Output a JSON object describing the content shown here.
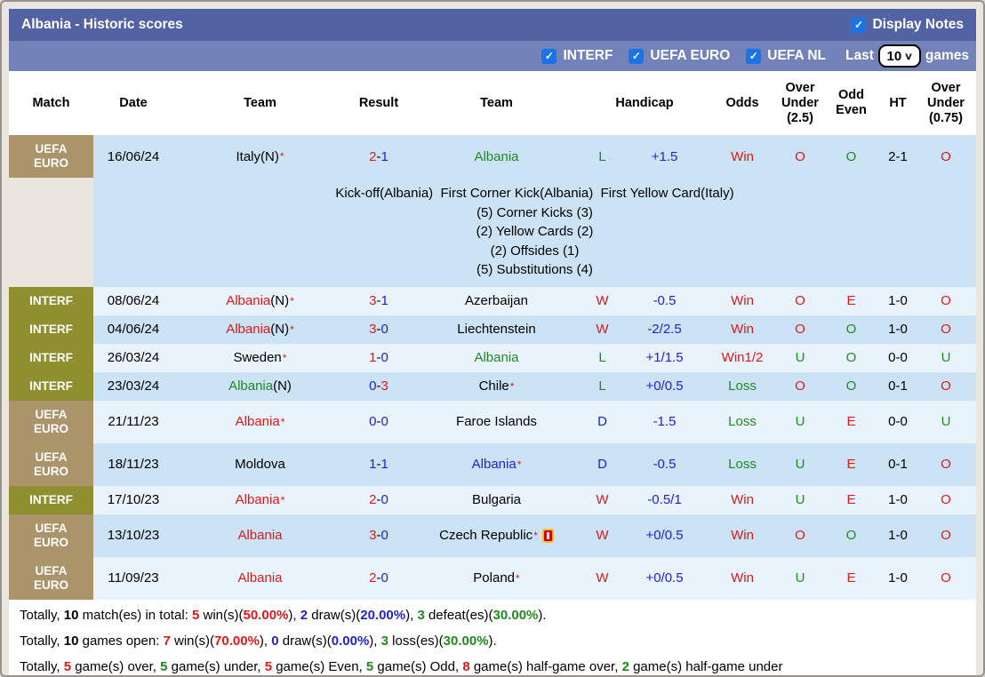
{
  "header": {
    "title": "Albania - Historic scores",
    "display_notes_label": "Display Notes",
    "filters": [
      {
        "label": "INTERF",
        "checked": true
      },
      {
        "label": "UEFA EURO",
        "checked": true
      },
      {
        "label": "UEFA NL",
        "checked": true
      }
    ],
    "last_label": "Last",
    "last_games_value": "10",
    "games_label": "games"
  },
  "table": {
    "columns": [
      "Match",
      "Date",
      "Team",
      "Result",
      "Team",
      "Handicap",
      "Odds",
      "Over Under (2.5)",
      "Odd Even",
      "HT",
      "Over Under (0.75)"
    ],
    "rows": [
      {
        "competition": "UEFA EURO",
        "date": "16/06/24",
        "home": {
          "name": "Italy",
          "suffix": "(N)",
          "star": true,
          "color": "black"
        },
        "score": {
          "home": "2",
          "away": "1",
          "home_color": "red",
          "away_color": "blue"
        },
        "away": {
          "name": "Albania",
          "suffix": "",
          "star": false,
          "color": "green"
        },
        "wdl": {
          "text": "L",
          "color": "green"
        },
        "handicap": "+1.5",
        "odds": {
          "text": "Win",
          "color": "red"
        },
        "over_under_25": {
          "text": "O",
          "color": "red"
        },
        "odd_even": {
          "text": "O",
          "color": "green"
        },
        "ht": "2-1",
        "over_under_075": {
          "text": "O",
          "color": "red"
        },
        "notes": [
          "Kick-off(Albania)  First Corner Kick(Albania)  First Yellow Card(Italy)",
          "(5) Corner Kicks (3)",
          "(2) Yellow Cards (2)",
          "(2) Offsides (1)",
          "(5) Substitutions (4)"
        ]
      },
      {
        "competition": "INTERF",
        "date": "08/06/24",
        "home": {
          "name": "Albania",
          "suffix": "(N)",
          "star": true,
          "color": "red"
        },
        "score": {
          "home": "3",
          "away": "1",
          "home_color": "red",
          "away_color": "blue"
        },
        "away": {
          "name": "Azerbaijan",
          "suffix": "",
          "star": false,
          "color": "black"
        },
        "wdl": {
          "text": "W",
          "color": "red"
        },
        "handicap": "-0.5",
        "odds": {
          "text": "Win",
          "color": "red"
        },
        "over_under_25": {
          "text": "O",
          "color": "red"
        },
        "odd_even": {
          "text": "E",
          "color": "red"
        },
        "ht": "1-0",
        "over_under_075": {
          "text": "O",
          "color": "red"
        }
      },
      {
        "competition": "INTERF",
        "date": "04/06/24",
        "home": {
          "name": "Albania",
          "suffix": "(N)",
          "star": true,
          "color": "red"
        },
        "score": {
          "home": "3",
          "away": "0",
          "home_color": "red",
          "away_color": "blue"
        },
        "away": {
          "name": "Liechtenstein",
          "suffix": "",
          "star": false,
          "color": "black"
        },
        "wdl": {
          "text": "W",
          "color": "red"
        },
        "handicap": "-2/2.5",
        "odds": {
          "text": "Win",
          "color": "red"
        },
        "over_under_25": {
          "text": "O",
          "color": "red"
        },
        "odd_even": {
          "text": "O",
          "color": "green"
        },
        "ht": "1-0",
        "over_under_075": {
          "text": "O",
          "color": "red"
        }
      },
      {
        "competition": "INTERF",
        "date": "26/03/24",
        "home": {
          "name": "Sweden",
          "suffix": "",
          "star": true,
          "color": "black"
        },
        "score": {
          "home": "1",
          "away": "0",
          "home_color": "red",
          "away_color": "blue"
        },
        "away": {
          "name": "Albania",
          "suffix": "",
          "star": false,
          "color": "green"
        },
        "wdl": {
          "text": "L",
          "color": "green"
        },
        "handicap": "+1/1.5",
        "odds": {
          "text": "Win1/2",
          "color": "red"
        },
        "over_under_25": {
          "text": "U",
          "color": "green"
        },
        "odd_even": {
          "text": "O",
          "color": "green"
        },
        "ht": "0-0",
        "over_under_075": {
          "text": "U",
          "color": "green"
        }
      },
      {
        "competition": "INTERF",
        "date": "23/03/24",
        "home": {
          "name": "Albania",
          "suffix": "(N)",
          "star": false,
          "color": "green"
        },
        "score": {
          "home": "0",
          "away": "3",
          "home_color": "blue",
          "away_color": "red"
        },
        "away": {
          "name": "Chile",
          "suffix": "",
          "star": true,
          "color": "black"
        },
        "wdl": {
          "text": "L",
          "color": "green"
        },
        "handicap": "+0/0.5",
        "odds": {
          "text": "Loss",
          "color": "green"
        },
        "over_under_25": {
          "text": "O",
          "color": "red"
        },
        "odd_even": {
          "text": "O",
          "color": "green"
        },
        "ht": "0-1",
        "over_under_075": {
          "text": "O",
          "color": "red"
        }
      },
      {
        "competition": "UEFA EURO",
        "date": "21/11/23",
        "home": {
          "name": "Albania",
          "suffix": "",
          "star": true,
          "color": "red"
        },
        "score": {
          "home": "0",
          "away": "0",
          "home_color": "blue",
          "away_color": "blue"
        },
        "away": {
          "name": "Faroe Islands",
          "suffix": "",
          "star": false,
          "color": "black"
        },
        "wdl": {
          "text": "D",
          "color": "blue"
        },
        "handicap": "-1.5",
        "odds": {
          "text": "Loss",
          "color": "green"
        },
        "over_under_25": {
          "text": "U",
          "color": "green"
        },
        "odd_even": {
          "text": "E",
          "color": "red"
        },
        "ht": "0-0",
        "over_under_075": {
          "text": "U",
          "color": "green"
        }
      },
      {
        "competition": "UEFA EURO",
        "date": "18/11/23",
        "home": {
          "name": "Moldova",
          "suffix": "",
          "star": false,
          "color": "black"
        },
        "score": {
          "home": "1",
          "away": "1",
          "home_color": "blue",
          "away_color": "blue"
        },
        "away": {
          "name": "Albania",
          "suffix": "",
          "star": true,
          "color": "blue"
        },
        "wdl": {
          "text": "D",
          "color": "blue"
        },
        "handicap": "-0.5",
        "odds": {
          "text": "Loss",
          "color": "green"
        },
        "over_under_25": {
          "text": "U",
          "color": "green"
        },
        "odd_even": {
          "text": "E",
          "color": "red"
        },
        "ht": "0-1",
        "over_under_075": {
          "text": "O",
          "color": "red"
        }
      },
      {
        "competition": "INTERF",
        "date": "17/10/23",
        "home": {
          "name": "Albania",
          "suffix": "",
          "star": true,
          "color": "red"
        },
        "score": {
          "home": "2",
          "away": "0",
          "home_color": "red",
          "away_color": "blue"
        },
        "away": {
          "name": "Bulgaria",
          "suffix": "",
          "star": false,
          "color": "black"
        },
        "wdl": {
          "text": "W",
          "color": "red"
        },
        "handicap": "-0.5/1",
        "odds": {
          "text": "Win",
          "color": "red"
        },
        "over_under_25": {
          "text": "U",
          "color": "green"
        },
        "odd_even": {
          "text": "E",
          "color": "red"
        },
        "ht": "1-0",
        "over_under_075": {
          "text": "O",
          "color": "red"
        }
      },
      {
        "competition": "UEFA EURO",
        "date": "13/10/23",
        "home": {
          "name": "Albania",
          "suffix": "",
          "star": false,
          "color": "red"
        },
        "score": {
          "home": "3",
          "away": "0",
          "home_color": "red",
          "away_color": "blue"
        },
        "away": {
          "name": "Czech Republic",
          "suffix": "",
          "star": true,
          "color": "black",
          "icon": "red-card"
        },
        "wdl": {
          "text": "W",
          "color": "red"
        },
        "handicap": "+0/0.5",
        "odds": {
          "text": "Win",
          "color": "red"
        },
        "over_under_25": {
          "text": "O",
          "color": "red"
        },
        "odd_even": {
          "text": "O",
          "color": "green"
        },
        "ht": "1-0",
        "over_under_075": {
          "text": "O",
          "color": "red"
        }
      },
      {
        "competition": "UEFA EURO",
        "date": "11/09/23",
        "home": {
          "name": "Albania",
          "suffix": "",
          "star": false,
          "color": "red"
        },
        "score": {
          "home": "2",
          "away": "0",
          "home_color": "red",
          "away_color": "blue"
        },
        "away": {
          "name": "Poland",
          "suffix": "",
          "star": true,
          "color": "black"
        },
        "wdl": {
          "text": "W",
          "color": "red"
        },
        "handicap": "+0/0.5",
        "odds": {
          "text": "Win",
          "color": "red"
        },
        "over_under_25": {
          "text": "U",
          "color": "green"
        },
        "odd_even": {
          "text": "E",
          "color": "red"
        },
        "ht": "1-0",
        "over_under_075": {
          "text": "O",
          "color": "red"
        }
      }
    ]
  },
  "footer": {
    "lines": [
      [
        {
          "t": "Totally, "
        },
        {
          "t": "10",
          "b": true
        },
        {
          "t": " match(es) in total: "
        },
        {
          "t": "5",
          "c": "red",
          "b": true
        },
        {
          "t": " win(s)("
        },
        {
          "t": "50.00%",
          "c": "red",
          "b": true
        },
        {
          "t": "), "
        },
        {
          "t": "2",
          "c": "blue",
          "b": true
        },
        {
          "t": " draw(s)("
        },
        {
          "t": "20.00%",
          "c": "blue",
          "b": true
        },
        {
          "t": "), "
        },
        {
          "t": "3",
          "c": "green",
          "b": true
        },
        {
          "t": " defeat(es)("
        },
        {
          "t": "30.00%",
          "c": "green",
          "b": true
        },
        {
          "t": ")."
        }
      ],
      [
        {
          "t": "Totally, "
        },
        {
          "t": "10",
          "b": true
        },
        {
          "t": " games open: "
        },
        {
          "t": "7",
          "c": "red",
          "b": true
        },
        {
          "t": " win(s)("
        },
        {
          "t": "70.00%",
          "c": "red",
          "b": true
        },
        {
          "t": "), "
        },
        {
          "t": "0",
          "c": "blue",
          "b": true
        },
        {
          "t": " draw(s)("
        },
        {
          "t": "0.00%",
          "c": "blue",
          "b": true
        },
        {
          "t": "), "
        },
        {
          "t": "3",
          "c": "green",
          "b": true
        },
        {
          "t": " loss(es)("
        },
        {
          "t": "30.00%",
          "c": "green",
          "b": true
        },
        {
          "t": ")."
        }
      ],
      [
        {
          "t": "Totally, "
        },
        {
          "t": "5",
          "c": "red",
          "b": true
        },
        {
          "t": " game(s) over, "
        },
        {
          "t": "5",
          "c": "green",
          "b": true
        },
        {
          "t": " game(s) under, "
        },
        {
          "t": "5",
          "c": "red",
          "b": true
        },
        {
          "t": " game(s) Even, "
        },
        {
          "t": "5",
          "c": "green",
          "b": true
        },
        {
          "t": " game(s) Odd, "
        },
        {
          "t": "8",
          "c": "red",
          "b": true
        },
        {
          "t": " game(s) half-game over, "
        },
        {
          "t": "2",
          "c": "green",
          "b": true
        },
        {
          "t": " game(s) half-game under"
        }
      ]
    ]
  },
  "colors": {
    "red": "#e01818",
    "blue": "#2222cc",
    "green": "#1f8b1f",
    "black": "#000000",
    "badge_uefa_euro": "#ab9469",
    "badge_interf": "#8f8f30",
    "row_medium": "#cbe3f5",
    "row_light": "#e9f3fb",
    "bar_dark": "#5263a4",
    "bar_light": "#7482ba",
    "checkbox_blue": "#1a73e8"
  }
}
